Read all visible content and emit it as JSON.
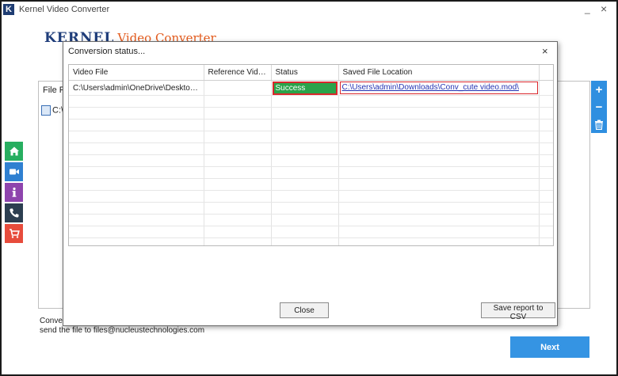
{
  "window": {
    "icon_letter": "K",
    "title": "Kernel Video Converter",
    "min_glyph": "_",
    "close_glyph": "×"
  },
  "brand": {
    "kernel": "KERNEL",
    "product": "Video Converter"
  },
  "sidebar": {
    "items": [
      {
        "name": "home",
        "color": "#27ae60"
      },
      {
        "name": "video",
        "color": "#2f80d1"
      },
      {
        "name": "info",
        "color": "#8e44ad"
      },
      {
        "name": "phone",
        "color": "#2c3e50"
      },
      {
        "name": "cart",
        "color": "#e74c3c"
      }
    ]
  },
  "background": {
    "column_file_label": "File Pa",
    "row_text": "C:\\"
  },
  "actions": {
    "add": "+",
    "remove": "−",
    "delete_icon": "trash-icon"
  },
  "bottom": {
    "line1": "Conver",
    "line2": "send the file to files@nucleustechnologies.com"
  },
  "next_label": "Next",
  "modal": {
    "title": "Conversion status...",
    "close_glyph": "×",
    "columns": [
      "Video File",
      "Reference Video...",
      "Status",
      "Saved File Location"
    ],
    "rows": [
      {
        "video_file": "C:\\Users\\admin\\OneDrive\\Desktop\\c...",
        "reference_video": "",
        "status": "Success",
        "saved_location": "C:\\Users\\admin\\Downloads\\Conv_cute video.mod\\"
      }
    ],
    "empty_rows": 13,
    "close_button": "Close",
    "csv_button": "Save report to CSV"
  },
  "colors": {
    "accent": "#3594e3",
    "success": "#2aa34a",
    "highlight": "#d9262b"
  }
}
